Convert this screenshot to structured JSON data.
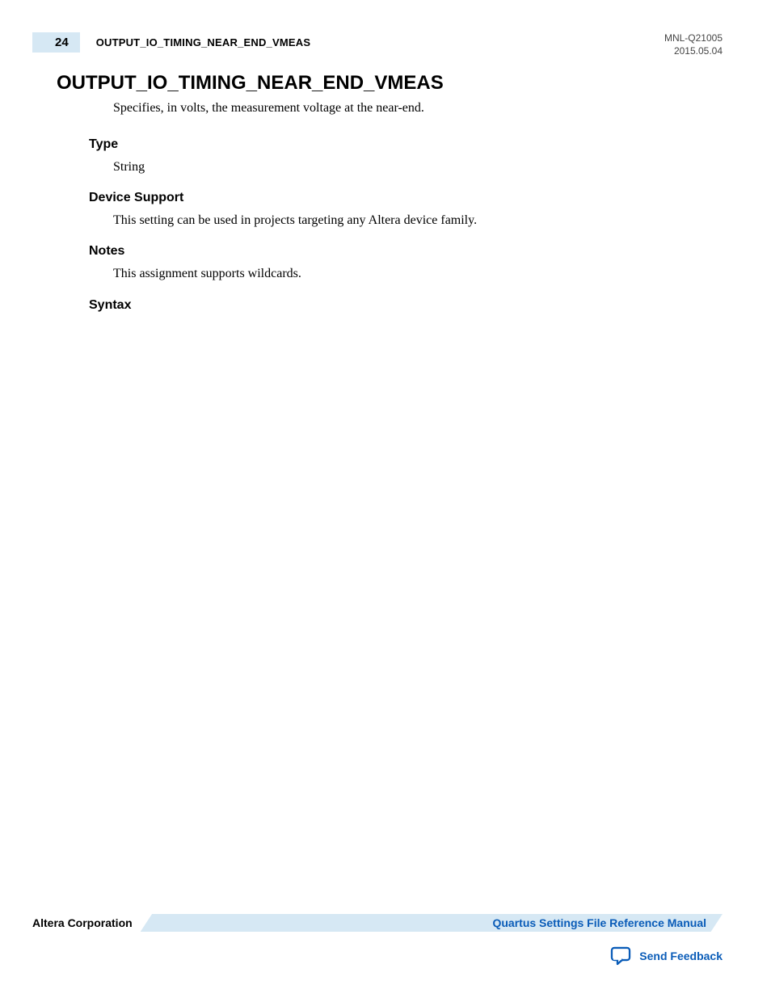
{
  "header": {
    "page_number": "24",
    "breadcrumb": "OUTPUT_IO_TIMING_NEAR_END_VMEAS",
    "doc_id": "MNL-Q21005",
    "date": "2015.05.04"
  },
  "title": "OUTPUT_IO_TIMING_NEAR_END_VMEAS",
  "description": "Specifies, in volts, the measurement voltage at the near-end.",
  "sections": {
    "type": {
      "heading": "Type",
      "body": "String"
    },
    "device_support": {
      "heading": "Device Support",
      "body": "This setting can be used in projects targeting any Altera device family."
    },
    "notes": {
      "heading": "Notes",
      "body": "This assignment supports wildcards."
    },
    "syntax": {
      "heading": "Syntax",
      "body": ""
    }
  },
  "footer": {
    "company": "Altera Corporation",
    "manual_title": "Quartus Settings File Reference Manual",
    "feedback_label": "Send Feedback"
  }
}
